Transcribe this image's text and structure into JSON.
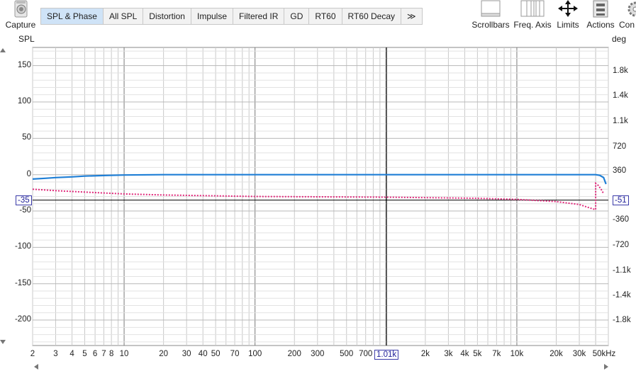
{
  "toolbar": {
    "capture_label": "Capture",
    "tabs": [
      "SPL & Phase",
      "All SPL",
      "Distortion",
      "Impulse",
      "Filtered IR",
      "GD",
      "RT60",
      "RT60 Decay"
    ],
    "more_label": "≫",
    "tools": [
      {
        "label": "Scrollbars",
        "icon": "scrollbars-icon"
      },
      {
        "label": "Freq. Axis",
        "icon": "freq-axis-icon"
      },
      {
        "label": "Limits",
        "icon": "limits-icon"
      },
      {
        "label": "Actions",
        "icon": "actions-icon"
      },
      {
        "label": "Con",
        "icon": "gear-icon"
      }
    ]
  },
  "chart_data": {
    "type": "line",
    "x_scale": "log",
    "x_unit": "kHz",
    "xlim": [
      2,
      50000
    ],
    "x_tick_labels": [
      "2",
      "3",
      "4",
      "5",
      "6",
      "7",
      "8",
      "10",
      "20",
      "30",
      "40",
      "50",
      "70",
      "100",
      "200",
      "300",
      "500",
      "700",
      "1.01k",
      "2k",
      "3k",
      "4k",
      "5k",
      "7k",
      "10k",
      "20k",
      "30k",
      "50kHz"
    ],
    "y_left_label": "SPL",
    "y_left_lim": [
      -235,
      175
    ],
    "y_left_ticks": [
      150,
      100,
      50,
      0,
      -50,
      -100,
      -150,
      -200
    ],
    "y_right_label": "deg",
    "y_right_ticks": [
      "1.8k",
      "1.4k",
      "1.1k",
      "720",
      "360",
      "-360",
      "-720",
      "-1.1k",
      "-1.4k",
      "-1.8k"
    ],
    "cursor": {
      "x_label": "1.01k",
      "left_value": "-35",
      "right_value": "-51"
    },
    "grid": true,
    "series": [
      {
        "color": "#1f7fd6",
        "style": "solid",
        "points": [
          [
            2,
            -6
          ],
          [
            2.5,
            -5
          ],
          [
            3,
            -4
          ],
          [
            4,
            -3
          ],
          [
            5,
            -2
          ],
          [
            7,
            -1.2
          ],
          [
            10,
            -0.5
          ],
          [
            20,
            0
          ],
          [
            100,
            0
          ],
          [
            1000,
            0
          ],
          [
            10000,
            0
          ],
          [
            40000,
            0
          ],
          [
            43000,
            -1
          ],
          [
            46000,
            -4
          ],
          [
            48000,
            -13
          ]
        ]
      },
      {
        "color": "#e0287a",
        "style": "dotted",
        "points": [
          [
            2,
            -20
          ],
          [
            3,
            -22
          ],
          [
            5,
            -24
          ],
          [
            10,
            -26.5
          ],
          [
            20,
            -28
          ],
          [
            100,
            -30
          ],
          [
            1000,
            -31
          ],
          [
            5000,
            -32.5
          ],
          [
            10000,
            -34
          ],
          [
            20000,
            -37
          ],
          [
            30000,
            -41
          ],
          [
            38000,
            -47
          ],
          [
            40000,
            -48
          ],
          [
            40000,
            -12
          ],
          [
            42000,
            -15
          ],
          [
            44000,
            -20
          ],
          [
            46000,
            -26
          ]
        ]
      }
    ]
  }
}
